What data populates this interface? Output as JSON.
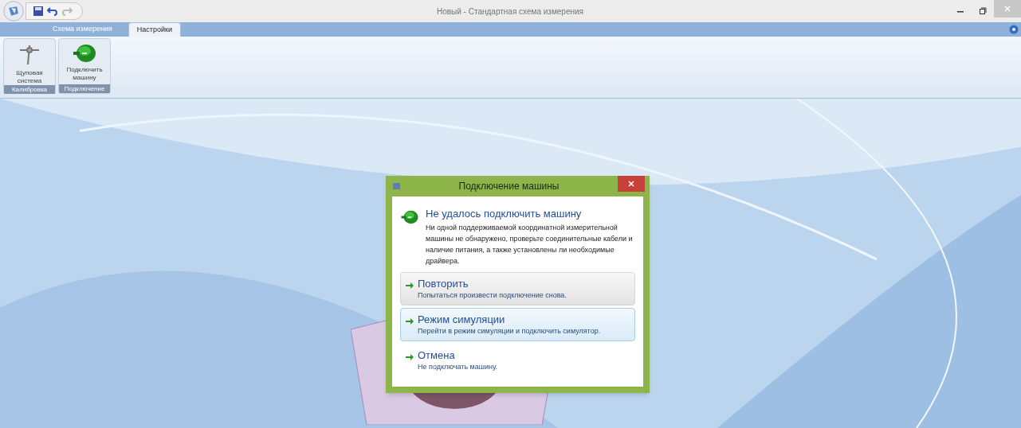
{
  "window": {
    "title": "Новый - Стандартная схема измерения"
  },
  "tabs": [
    {
      "label": "Схема измерения",
      "selected": false
    },
    {
      "label": "Настройки",
      "selected": true
    }
  ],
  "ribbon": {
    "groups": [
      {
        "label": "Калибровка",
        "buttons": [
          {
            "label": "Щуповая система",
            "kind": "probe"
          }
        ]
      },
      {
        "label": "Подключение",
        "buttons": [
          {
            "label": "Подключить машину",
            "kind": "machine"
          }
        ]
      }
    ]
  },
  "dialog": {
    "title": "Подключение машины",
    "heading": "Не удалось подключить машину",
    "message": "Ни одной поддерживаемой координатной измерительной машины не обнаружено, проверьте соединительные кабели и наличие питания, а также установлены ли необходимые драйвера.",
    "options": [
      {
        "title": "Повторить",
        "description": "Попытаться произвести подключение снова.",
        "hovered": true,
        "selected": false
      },
      {
        "title": "Режим симуляции",
        "description": "Перейти в режим симуляции и подключить симулятор.",
        "hovered": false,
        "selected": true
      },
      {
        "title": "Отмена",
        "description": "Не подключать машину.",
        "hovered": false,
        "selected": false
      }
    ]
  }
}
